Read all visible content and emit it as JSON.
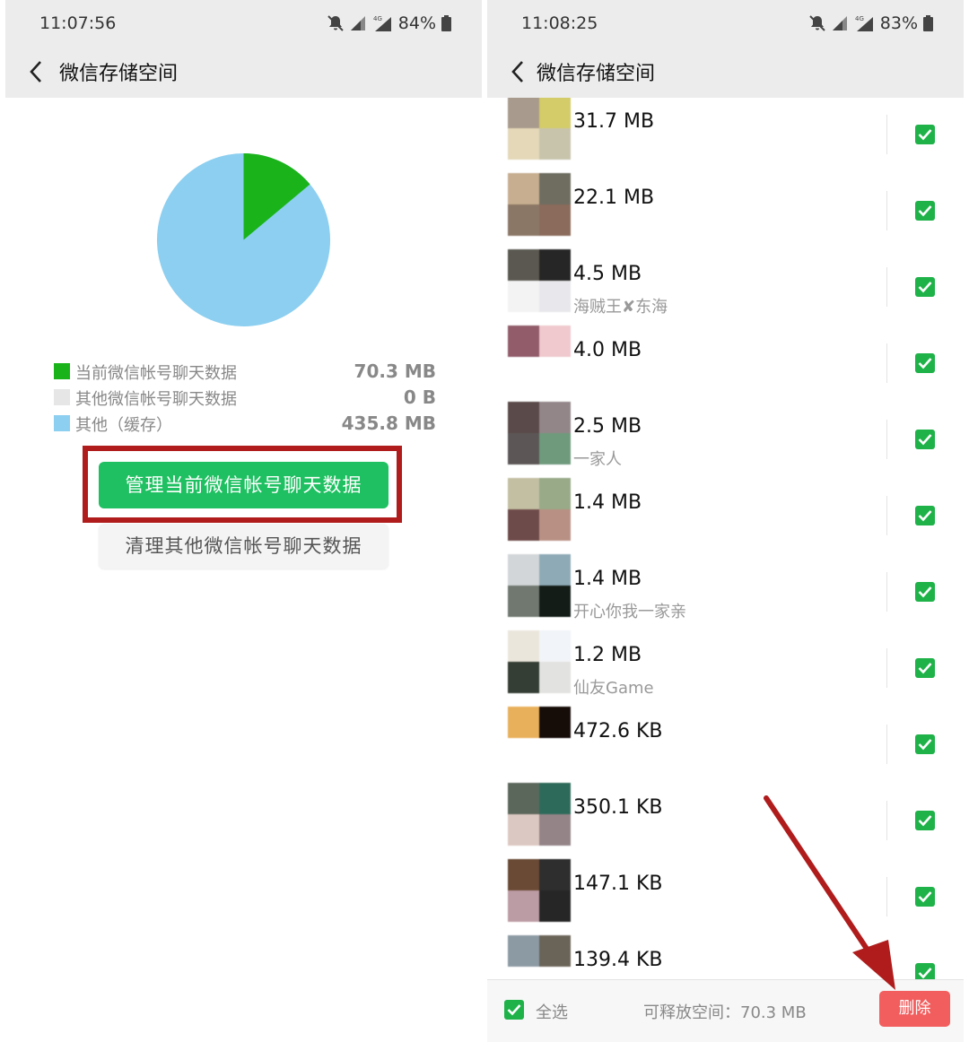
{
  "left": {
    "status": {
      "time": "11:07:56",
      "battery": "84%",
      "network": "4G"
    },
    "header": {
      "title": "微信存储空间"
    },
    "pie": {
      "green_fraction": 0.139,
      "colors": {
        "current": "#1ab31a",
        "other_account": "#e6e6e6",
        "cache": "#8ccff0"
      }
    },
    "legend": [
      {
        "label": "当前微信帐号聊天数据",
        "value": "70.3 MB",
        "color": "#1ab31a"
      },
      {
        "label": "其他微信帐号聊天数据",
        "value": "0 B",
        "color": "#e6e6e6"
      },
      {
        "label": "其他（缓存）",
        "value": "435.8 MB",
        "color": "#8ccff0"
      }
    ],
    "buttons": {
      "manage": "管理当前微信帐号聊天数据",
      "clean": "清理其他微信帐号聊天数据"
    }
  },
  "right": {
    "status": {
      "time": "11:08:25",
      "battery": "83%",
      "network": "4G"
    },
    "header": {
      "title": "微信存储空间"
    },
    "items": [
      {
        "size": "31.7 MB",
        "name": "",
        "colors": [
          "#a89a8c",
          "#d4cc68",
          "#e4d8b8",
          "#c8c4ac"
        ]
      },
      {
        "size": "22.1 MB",
        "name": "",
        "colors": [
          "#c7ae90",
          "#6e6d60",
          "#8b7766",
          "#8b6b5c"
        ]
      },
      {
        "size": "4.5 MB",
        "name": "海贼王✘东海",
        "colors": [
          "#5a5850",
          "#262626",
          "#f3f3f3",
          "#e8e8ec"
        ]
      },
      {
        "size": "4.0 MB",
        "name": "",
        "colors": [
          "#925c6a",
          "#efc9cd",
          "#ffffff",
          "#ffffff"
        ]
      },
      {
        "size": "2.5 MB",
        "name": "一家人",
        "colors": [
          "#5a4a49",
          "#928689",
          "#5c5657",
          "#6f9a7c"
        ]
      },
      {
        "size": "1.4 MB",
        "name": "",
        "colors": [
          "#c3bfa3",
          "#98aa88",
          "#6e4b4b",
          "#b99184"
        ]
      },
      {
        "size": "1.4 MB",
        "name": "开心你我一家亲",
        "colors": [
          "#d2d6d8",
          "#8eaab6",
          "#707870",
          "#141c18"
        ]
      },
      {
        "size": "1.2 MB",
        "name": "仙友Game",
        "colors": [
          "#ebe6dc",
          "#f1f4f8",
          "#343e34",
          "#e2e2e0"
        ]
      },
      {
        "size": "472.6 KB",
        "name": "",
        "colors": [
          "#e8b05a",
          "#160c08",
          "#ffffff",
          "#ffffff"
        ]
      },
      {
        "size": "350.1 KB",
        "name": "",
        "colors": [
          "#5c675c",
          "#2e6a5a",
          "#dcc8c2",
          "#948488"
        ]
      },
      {
        "size": "147.1 KB",
        "name": "",
        "colors": [
          "#6a4a34",
          "#2e2e2e",
          "#bc9ca4",
          "#262626"
        ]
      },
      {
        "size": "139.4 KB",
        "name": "",
        "colors": [
          "#8c9aa4",
          "#6a6458",
          "#ffffff",
          "#ffffff"
        ]
      }
    ],
    "bottom": {
      "select_all": "全选",
      "free_space": "可释放空间：70.3 MB",
      "delete": "删除"
    }
  }
}
